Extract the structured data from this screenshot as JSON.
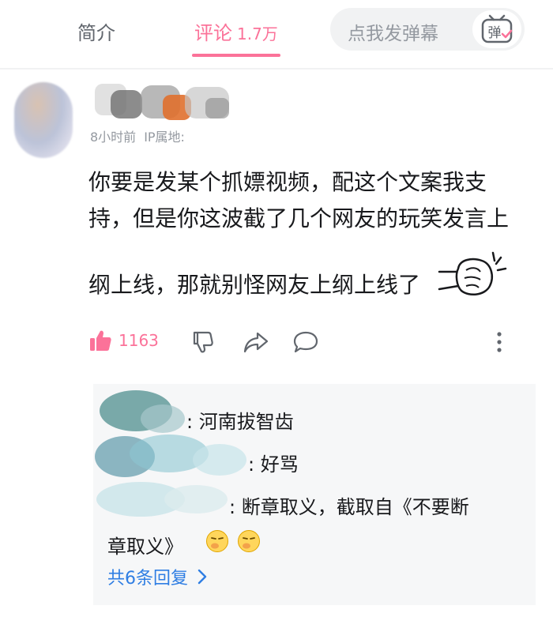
{
  "tabs": {
    "intro_label": "简介",
    "comments_label": "评论",
    "comments_count": "1.7万",
    "accent_color": "#fb7299"
  },
  "danmaku": {
    "placeholder": "点我发弹幕",
    "button_glyph": "弹"
  },
  "comment": {
    "time": "8小时前",
    "ip_label": "IP属地:",
    "body_lines": [
      "你要是发某个抓嫖视频，配这个文案我支",
      "持，但是你这波截了几个网友的玩笑发言上",
      "纲上线，那就别怪网友上纲上线了"
    ],
    "like_count": "1163",
    "icons": [
      "thumb-up-icon",
      "thumb-down-icon",
      "share-icon",
      "reply-icon",
      "more-vertical-icon"
    ]
  },
  "replies": {
    "items": [
      {
        "text": ": 河南拔智齿"
      },
      {
        "text": ": 好骂"
      },
      {
        "text": ": 断章取义，截取自《不要断",
        "continuation": "章取义》"
      }
    ],
    "more_label": "共6条回复",
    "link_color": "#2f7ee3"
  }
}
